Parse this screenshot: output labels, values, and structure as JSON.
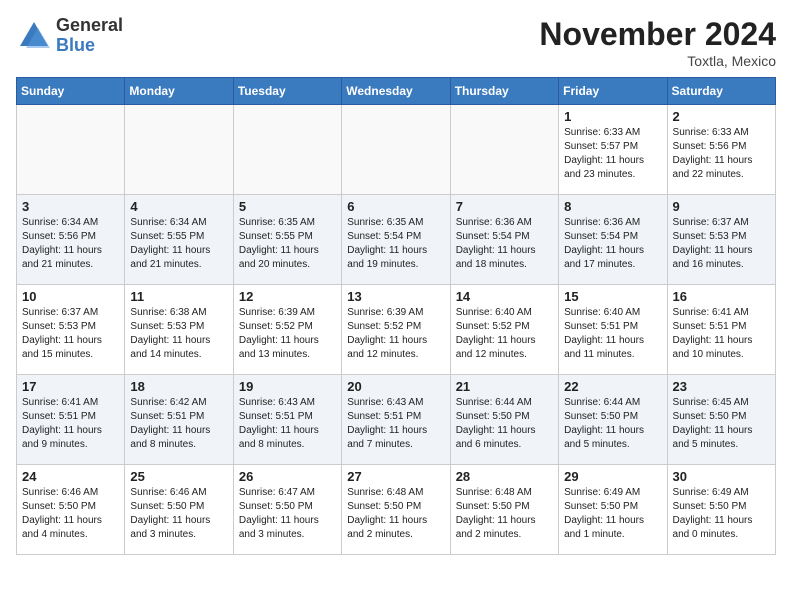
{
  "logo": {
    "general": "General",
    "blue": "Blue"
  },
  "header": {
    "month": "November 2024",
    "location": "Toxtla, Mexico"
  },
  "days_of_week": [
    "Sunday",
    "Monday",
    "Tuesday",
    "Wednesday",
    "Thursday",
    "Friday",
    "Saturday"
  ],
  "weeks": [
    [
      {
        "day": "",
        "info": ""
      },
      {
        "day": "",
        "info": ""
      },
      {
        "day": "",
        "info": ""
      },
      {
        "day": "",
        "info": ""
      },
      {
        "day": "",
        "info": ""
      },
      {
        "day": "1",
        "info": "Sunrise: 6:33 AM\nSunset: 5:57 PM\nDaylight: 11 hours and 23 minutes."
      },
      {
        "day": "2",
        "info": "Sunrise: 6:33 AM\nSunset: 5:56 PM\nDaylight: 11 hours and 22 minutes."
      }
    ],
    [
      {
        "day": "3",
        "info": "Sunrise: 6:34 AM\nSunset: 5:56 PM\nDaylight: 11 hours and 21 minutes."
      },
      {
        "day": "4",
        "info": "Sunrise: 6:34 AM\nSunset: 5:55 PM\nDaylight: 11 hours and 21 minutes."
      },
      {
        "day": "5",
        "info": "Sunrise: 6:35 AM\nSunset: 5:55 PM\nDaylight: 11 hours and 20 minutes."
      },
      {
        "day": "6",
        "info": "Sunrise: 6:35 AM\nSunset: 5:54 PM\nDaylight: 11 hours and 19 minutes."
      },
      {
        "day": "7",
        "info": "Sunrise: 6:36 AM\nSunset: 5:54 PM\nDaylight: 11 hours and 18 minutes."
      },
      {
        "day": "8",
        "info": "Sunrise: 6:36 AM\nSunset: 5:54 PM\nDaylight: 11 hours and 17 minutes."
      },
      {
        "day": "9",
        "info": "Sunrise: 6:37 AM\nSunset: 5:53 PM\nDaylight: 11 hours and 16 minutes."
      }
    ],
    [
      {
        "day": "10",
        "info": "Sunrise: 6:37 AM\nSunset: 5:53 PM\nDaylight: 11 hours and 15 minutes."
      },
      {
        "day": "11",
        "info": "Sunrise: 6:38 AM\nSunset: 5:53 PM\nDaylight: 11 hours and 14 minutes."
      },
      {
        "day": "12",
        "info": "Sunrise: 6:39 AM\nSunset: 5:52 PM\nDaylight: 11 hours and 13 minutes."
      },
      {
        "day": "13",
        "info": "Sunrise: 6:39 AM\nSunset: 5:52 PM\nDaylight: 11 hours and 12 minutes."
      },
      {
        "day": "14",
        "info": "Sunrise: 6:40 AM\nSunset: 5:52 PM\nDaylight: 11 hours and 12 minutes."
      },
      {
        "day": "15",
        "info": "Sunrise: 6:40 AM\nSunset: 5:51 PM\nDaylight: 11 hours and 11 minutes."
      },
      {
        "day": "16",
        "info": "Sunrise: 6:41 AM\nSunset: 5:51 PM\nDaylight: 11 hours and 10 minutes."
      }
    ],
    [
      {
        "day": "17",
        "info": "Sunrise: 6:41 AM\nSunset: 5:51 PM\nDaylight: 11 hours and 9 minutes."
      },
      {
        "day": "18",
        "info": "Sunrise: 6:42 AM\nSunset: 5:51 PM\nDaylight: 11 hours and 8 minutes."
      },
      {
        "day": "19",
        "info": "Sunrise: 6:43 AM\nSunset: 5:51 PM\nDaylight: 11 hours and 8 minutes."
      },
      {
        "day": "20",
        "info": "Sunrise: 6:43 AM\nSunset: 5:51 PM\nDaylight: 11 hours and 7 minutes."
      },
      {
        "day": "21",
        "info": "Sunrise: 6:44 AM\nSunset: 5:50 PM\nDaylight: 11 hours and 6 minutes."
      },
      {
        "day": "22",
        "info": "Sunrise: 6:44 AM\nSunset: 5:50 PM\nDaylight: 11 hours and 5 minutes."
      },
      {
        "day": "23",
        "info": "Sunrise: 6:45 AM\nSunset: 5:50 PM\nDaylight: 11 hours and 5 minutes."
      }
    ],
    [
      {
        "day": "24",
        "info": "Sunrise: 6:46 AM\nSunset: 5:50 PM\nDaylight: 11 hours and 4 minutes."
      },
      {
        "day": "25",
        "info": "Sunrise: 6:46 AM\nSunset: 5:50 PM\nDaylight: 11 hours and 3 minutes."
      },
      {
        "day": "26",
        "info": "Sunrise: 6:47 AM\nSunset: 5:50 PM\nDaylight: 11 hours and 3 minutes."
      },
      {
        "day": "27",
        "info": "Sunrise: 6:48 AM\nSunset: 5:50 PM\nDaylight: 11 hours and 2 minutes."
      },
      {
        "day": "28",
        "info": "Sunrise: 6:48 AM\nSunset: 5:50 PM\nDaylight: 11 hours and 2 minutes."
      },
      {
        "day": "29",
        "info": "Sunrise: 6:49 AM\nSunset: 5:50 PM\nDaylight: 11 hours and 1 minute."
      },
      {
        "day": "30",
        "info": "Sunrise: 6:49 AM\nSunset: 5:50 PM\nDaylight: 11 hours and 0 minutes."
      }
    ]
  ]
}
